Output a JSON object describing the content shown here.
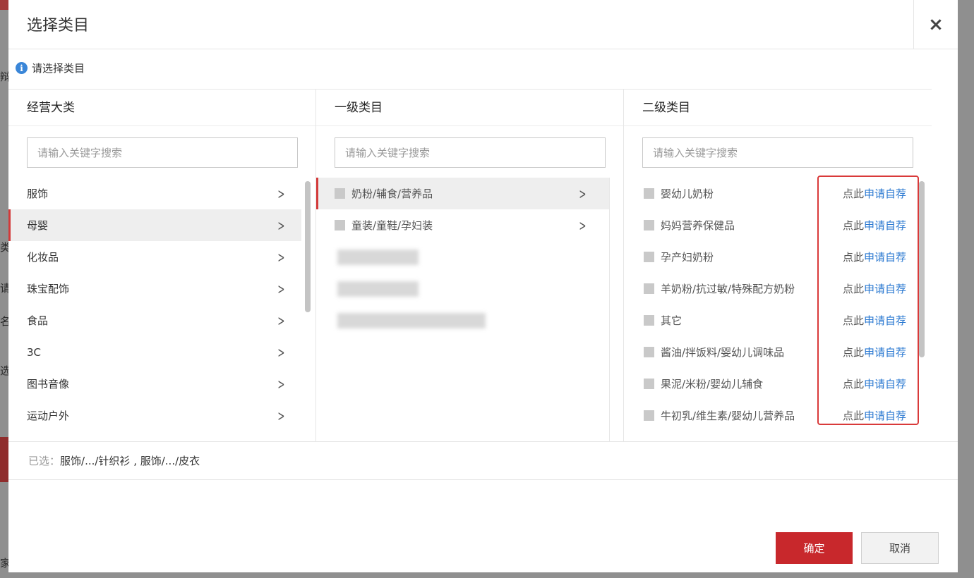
{
  "modal": {
    "title": "选择类目",
    "close_glyph": "×",
    "hint": "请选择类目",
    "info_glyph": "i"
  },
  "columns": {
    "col1": {
      "header": "经营大类",
      "search_placeholder": "请输入关键字搜索",
      "items": [
        "服饰",
        "母婴",
        "化妆品",
        "珠宝配饰",
        "食品",
        "3C",
        "图书音像",
        "运动户外"
      ],
      "active_index": 1
    },
    "col2": {
      "header": "一级类目",
      "search_placeholder": "请输入关键字搜索",
      "items": [
        "奶粉/辅食/营养品",
        "童装/童鞋/孕妇装"
      ],
      "active_index": 0
    },
    "col3": {
      "header": "二级类目",
      "search_placeholder": "请输入关键字搜索",
      "link_prefix": "点此",
      "link_text": "申请自荐",
      "items": [
        "婴幼儿奶粉",
        "妈妈营养保健品",
        "孕产妇奶粉",
        "羊奶粉/抗过敏/特殊配方奶粉",
        "其它",
        "酱油/拌饭料/婴幼儿调味品",
        "果泥/米粉/婴幼儿辅食",
        "牛初乳/维生素/婴幼儿营养品"
      ]
    }
  },
  "chevron_glyph": ">",
  "selected": {
    "label": "已选：",
    "value": "服饰/.../针织衫 , 服饰/.../皮衣"
  },
  "buttons": {
    "ok": "确定",
    "cancel": "取消"
  },
  "backdrop_glyphs": [
    "辩",
    "类",
    "请",
    "名",
    "选",
    "家"
  ],
  "colors": {
    "accent_red": "#c8282c",
    "link_blue": "#2a78d1",
    "info_blue": "#3a86d8"
  }
}
